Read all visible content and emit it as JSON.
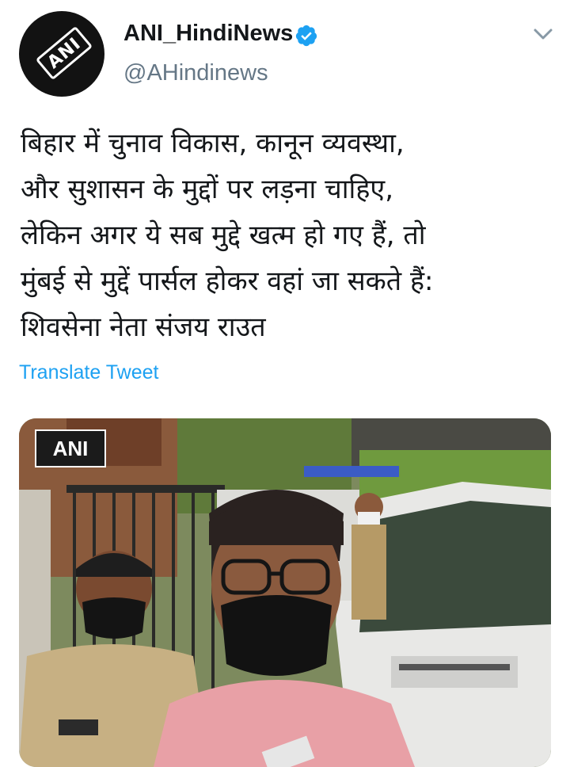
{
  "user": {
    "display_name": "ANI_HindiNews",
    "handle": "@AHindinews",
    "avatar_text": "ANI",
    "verified_icon": "verified-badge-icon"
  },
  "tweet": {
    "lines": [
      "बिहार में चुनाव विकास, कानून व्यवस्था,",
      "और सुशासन के मुद्दों पर लड़ना चाहिए,",
      "लेकिन अगर ये सब मुद्दे खत्म हो गए हैं, तो",
      "मुंबई से मुद्दें पार्सल होकर वहां जा सकते हैं:",
      "शिवसेना नेता संजय राउत"
    ],
    "translate_label": "Translate Tweet"
  },
  "media": {
    "watermark": "ANI"
  },
  "colors": {
    "link": "#1da1f2",
    "secondary_text": "#657786",
    "verified": "#1da1f2"
  }
}
